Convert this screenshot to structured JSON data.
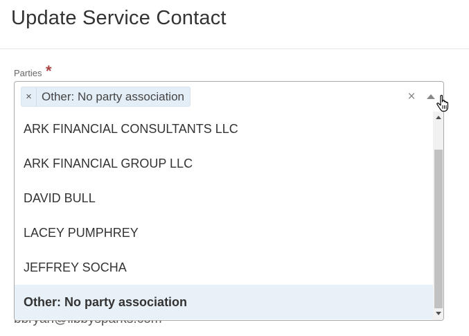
{
  "header": {
    "title": "Update Service Contact"
  },
  "parties_field": {
    "label": "Parties",
    "required_mark": "*",
    "selected_chip": {
      "remove_glyph": "×",
      "label": "Other: No party association"
    },
    "clear_glyph": "×",
    "toggle_icon": "caret-up-icon",
    "options": [
      {
        "label": "ARK FINANCIAL CONSULTANTS LLC",
        "selected": false
      },
      {
        "label": "ARK FINANCIAL GROUP LLC",
        "selected": false
      },
      {
        "label": "DAVID BULL",
        "selected": false
      },
      {
        "label": "LACEY PUMPHREY",
        "selected": false
      },
      {
        "label": "JEFFREY SOCHA",
        "selected": false
      },
      {
        "label": "Other: No party association",
        "selected": true
      }
    ]
  },
  "partially_hidden_field": {
    "text": "bbryan@libbysparks.com"
  },
  "colors": {
    "required": "#a94442",
    "chip_background": "#e4eef7",
    "selected_option_background": "#e8f1f8",
    "border": "#aaaaaa"
  }
}
